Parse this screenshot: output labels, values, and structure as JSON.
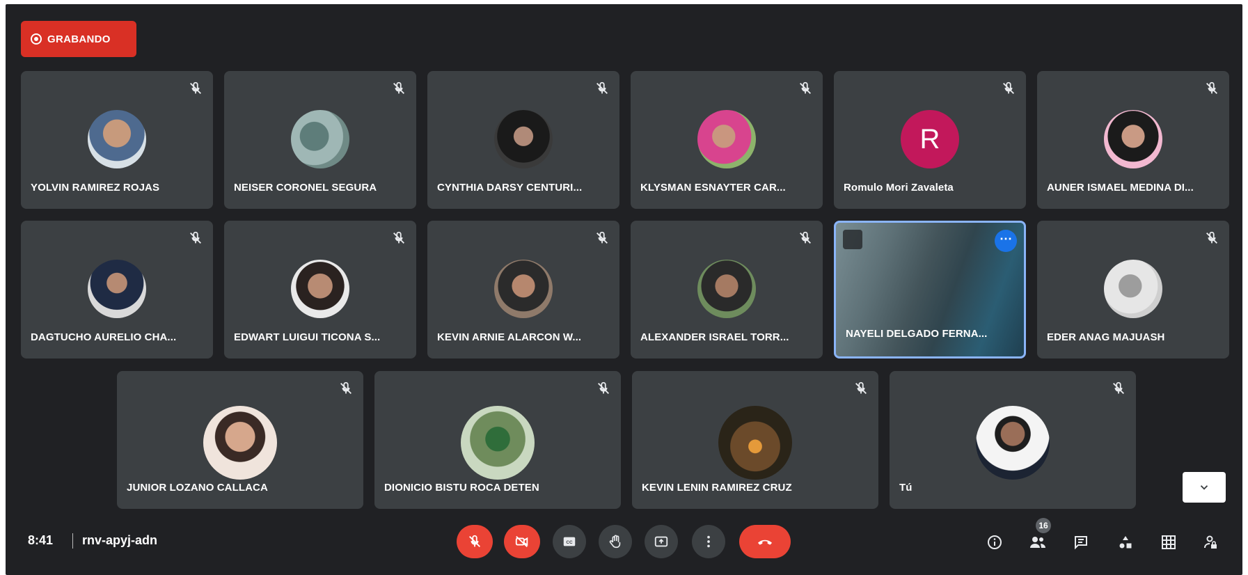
{
  "recording": {
    "label": "GRABANDO"
  },
  "participants": [
    {
      "name": "YOLVIN RAMIREZ ROJAS"
    },
    {
      "name": "NEISER CORONEL SEGURA"
    },
    {
      "name": "CYNTHIA DARSY CENTURI..."
    },
    {
      "name": "KLYSMAN ESNAYTER CAR..."
    },
    {
      "name": "Romulo Mori Zavaleta",
      "initial": "R"
    },
    {
      "name": "AUNER ISMAEL MEDINA DI..."
    },
    {
      "name": "DAGTUCHO AURELIO CHA..."
    },
    {
      "name": "EDWART LUIGUI TICONA S..."
    },
    {
      "name": "KEVIN ARNIE ALARCON W..."
    },
    {
      "name": "ALEXANDER ISRAEL TORR..."
    },
    {
      "name": "NAYELI DELGADO FERNA..."
    },
    {
      "name": "EDER ANAG MAJUASH"
    },
    {
      "name": "JUNIOR LOZANO CALLACA"
    },
    {
      "name": "DIONICIO BISTU ROCA DETEN"
    },
    {
      "name": "KEVIN LENIN RAMIREZ CRUZ"
    },
    {
      "name": "Tú"
    }
  ],
  "footer": {
    "time": "8:41",
    "meeting_code": "rnv-apyj-adn",
    "participants_count": "16"
  },
  "colors": {
    "background": "#202124",
    "tile": "#3c4043",
    "red": "#ea4335",
    "highlight": "#8ab4f8",
    "avatar_r": "#c2185b"
  }
}
